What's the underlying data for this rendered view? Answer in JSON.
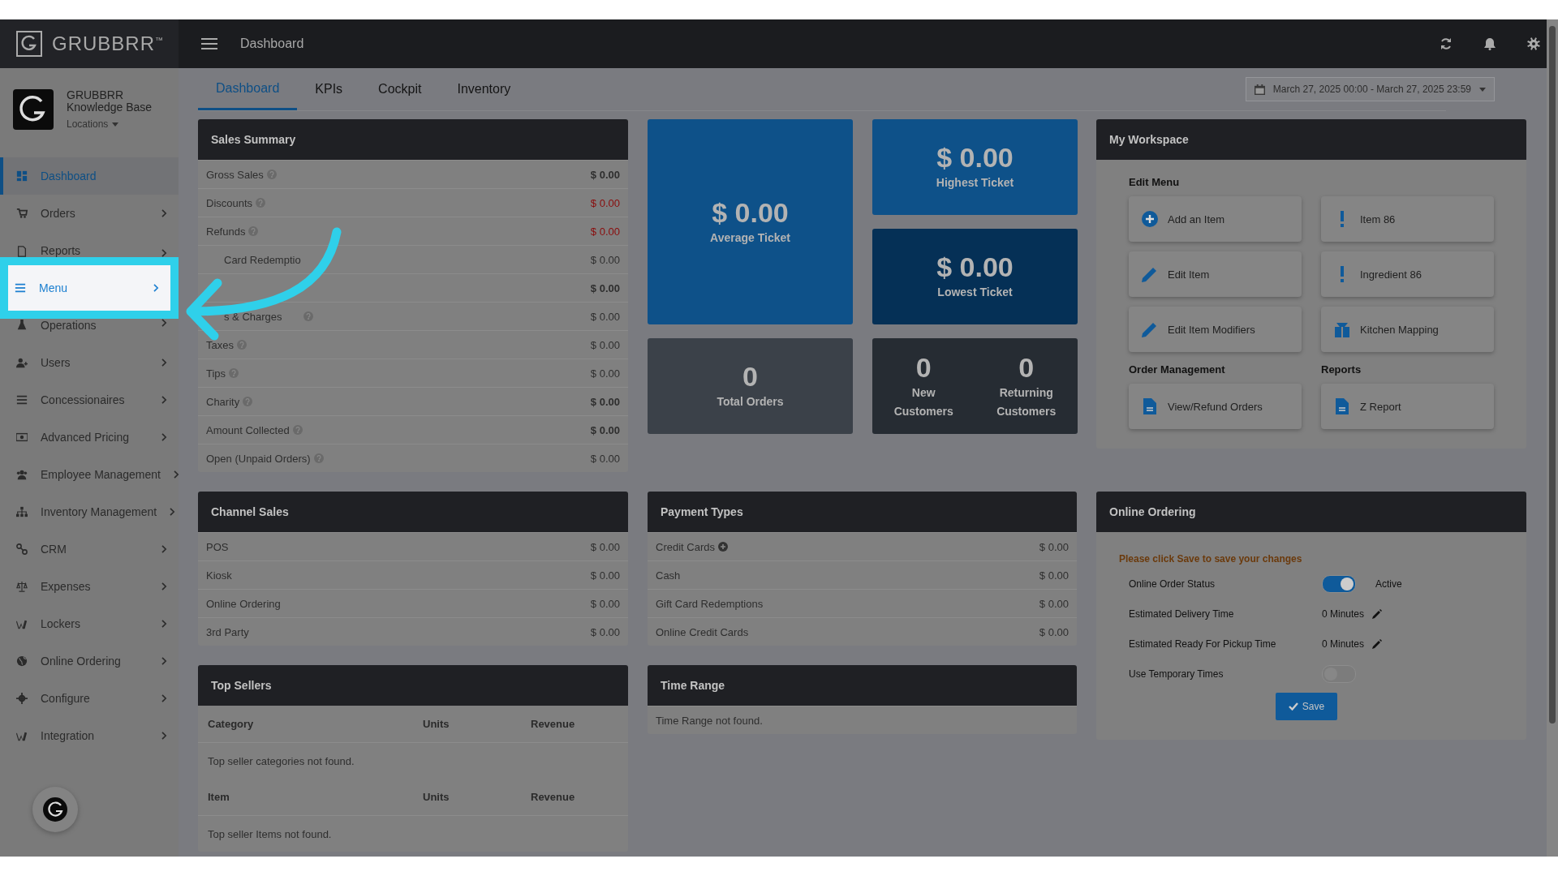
{
  "app": {
    "logo": "GRUBBRR$^{™}$",
    "page_title": "Dashboard"
  },
  "account": {
    "name": "GRUBBRR Knowledge Base",
    "locations": "Locations"
  },
  "sidebar": {
    "items": [
      {
        "label": "Dashboard",
        "selected": true,
        "spotlight": false,
        "has_children": false
      },
      {
        "label": "Orders",
        "selected": false,
        "spotlight": false,
        "has_children": true
      },
      {
        "label": "Reports",
        "selected": false,
        "spotlight": false,
        "has_children": true
      },
      {
        "label": "Menu",
        "selected": false,
        "spotlight": true,
        "has_children": true
      },
      {
        "label": "Operations",
        "selected": false,
        "spotlight": false,
        "has_children": true
      },
      {
        "label": "Users",
        "selected": false,
        "spotlight": false,
        "has_children": true
      },
      {
        "label": "Concessionaires",
        "selected": false,
        "spotlight": false,
        "has_children": true
      },
      {
        "label": "Advanced Pricing",
        "selected": false,
        "spotlight": false,
        "has_children": true
      },
      {
        "label": "Employee Management",
        "selected": false,
        "spotlight": false,
        "has_children": true
      },
      {
        "label": "Inventory Management",
        "selected": false,
        "spotlight": false,
        "has_children": true
      },
      {
        "label": "CRM",
        "selected": false,
        "spotlight": false,
        "has_children": true
      },
      {
        "label": "Expenses",
        "selected": false,
        "spotlight": false,
        "has_children": true
      },
      {
        "label": "Lockers",
        "selected": false,
        "spotlight": false,
        "has_children": true
      },
      {
        "label": "Online Ordering",
        "selected": false,
        "spotlight": false,
        "has_children": true
      },
      {
        "label": "Configure",
        "selected": false,
        "spotlight": false,
        "has_children": true
      },
      {
        "label": "Integration",
        "selected": false,
        "spotlight": false,
        "has_children": true
      }
    ]
  },
  "tabs": [
    {
      "label": "Dashboard",
      "selected": true
    },
    {
      "label": "KPIs",
      "selected": false
    },
    {
      "label": "Cockpit",
      "selected": false
    },
    {
      "label": "Inventory",
      "selected": false
    }
  ],
  "date_range": "March 27, 2025 00:00 - March 27, 2025 23:59",
  "sales_summary": {
    "title": "Sales Summary",
    "rows": [
      {
        "label": "Gross Sales",
        "value": "$ 0.00",
        "help": true,
        "negative": false,
        "bold": true,
        "partly_hidden": false
      },
      {
        "label": "Discounts",
        "value": "$ 0.00",
        "help": true,
        "negative": true,
        "bold": false,
        "partly_hidden": false
      },
      {
        "label": "Refunds",
        "value": "$ 0.00",
        "help": true,
        "negative": true,
        "bold": false,
        "partly_hidden": false
      },
      {
        "label": "Card Redemptio",
        "value": "$ 0.00",
        "help": false,
        "negative": false,
        "bold": false,
        "partly_hidden": true
      },
      {
        "value": "$ 0.00",
        "help": false,
        "negative": false,
        "bold": true
      },
      {
        "label": "s & Charges",
        "value": "$ 0.00",
        "help": true,
        "negative": false,
        "bold": false,
        "partly_hidden": true
      },
      {
        "label": "Taxes",
        "value": "$ 0.00",
        "help": true,
        "negative": false,
        "bold": false,
        "partly_hidden": false
      },
      {
        "label": "Tips",
        "value": "$ 0.00",
        "help": true,
        "negative": false,
        "bold": false,
        "partly_hidden": false
      },
      {
        "label": "Charity",
        "value": "$ 0.00",
        "help": true,
        "negative": false,
        "bold": true,
        "partly_hidden": false
      },
      {
        "label": "Amount Collected",
        "value": "$ 0.00",
        "help": true,
        "negative": false,
        "bold": true,
        "partly_hidden": false
      },
      {
        "label": "Open (Unpaid Orders)",
        "value": "$ 0.00",
        "help": true,
        "negative": false,
        "bold": false,
        "partly_hidden": false
      }
    ]
  },
  "tiles": [
    {
      "kind": "big",
      "value": "$ 0.00",
      "label": "Average Ticket"
    },
    {
      "kind": "small",
      "value": "$ 0.00",
      "label": "Highest Ticket"
    },
    {
      "kind": "small",
      "value": "$ 0.00",
      "label": "Lowest Ticket"
    },
    {
      "kind": "count",
      "value": "0",
      "label": "Total Orders"
    },
    {
      "kind": "pair",
      "parts": [
        {
          "value": "0",
          "label": "New Customers"
        },
        {
          "value": "0",
          "label": "Returning Customers"
        }
      ]
    }
  ],
  "workspace": {
    "title": "My Workspace",
    "sections": [
      {
        "title": "Edit Menu",
        "wide": true,
        "buttons": [
          "Add an Item",
          "Item 86",
          "Edit Item",
          "Ingredient 86",
          "Edit Item Modifiers",
          "Kitchen Mapping"
        ]
      },
      {
        "title": "Order Management",
        "wide": false,
        "buttons": [
          "View/Refund Orders"
        ]
      },
      {
        "title": "Reports",
        "wide": false,
        "buttons": [
          "Z Report"
        ]
      }
    ]
  },
  "channel_sales": {
    "title": "Channel Sales",
    "rows": [
      {
        "label": "POS",
        "value": "$ 0.00"
      },
      {
        "label": "Kiosk",
        "value": "$ 0.00"
      },
      {
        "label": "Online Ordering",
        "value": "$ 0.00"
      },
      {
        "label": "3rd Party",
        "value": "$ 0.00"
      }
    ]
  },
  "payment_types": {
    "title": "Payment Types",
    "rows": [
      {
        "label": "Credit Cards",
        "value": "$ 0.00",
        "expandable": true
      },
      {
        "label": "Cash",
        "value": "$ 0.00",
        "expandable": false
      },
      {
        "label": "Gift Card Redemptions",
        "value": "$ 0.00",
        "expandable": false
      },
      {
        "label": "Online Credit Cards",
        "value": "$ 0.00",
        "expandable": false
      }
    ]
  },
  "online_ordering": {
    "title": "Online Ordering",
    "notice": "Please click Save to save your changes",
    "rows": [
      {
        "kind": "toggle",
        "label": "Online Order Status",
        "on": true,
        "state_text": "Active"
      },
      {
        "kind": "time",
        "label": "Estimated Delivery Time",
        "value": "0 Minutes"
      },
      {
        "kind": "time",
        "label": "Estimated Ready For Pickup Time",
        "value": "0 Minutes"
      },
      {
        "kind": "toggle",
        "label": "Use Temporary Times",
        "on": false
      }
    ],
    "save": "Save"
  },
  "top_sellers": {
    "title": "Top Sellers",
    "tables": [
      {
        "columns": [
          "Category",
          "Units",
          "Revenue"
        ],
        "empty": "Top seller categories not found."
      },
      {
        "columns": [
          "Item",
          "Units",
          "Revenue"
        ],
        "empty": "Top seller Items not found."
      }
    ]
  },
  "time_range": {
    "title": "Time Range",
    "empty": "Time Range not found."
  }
}
